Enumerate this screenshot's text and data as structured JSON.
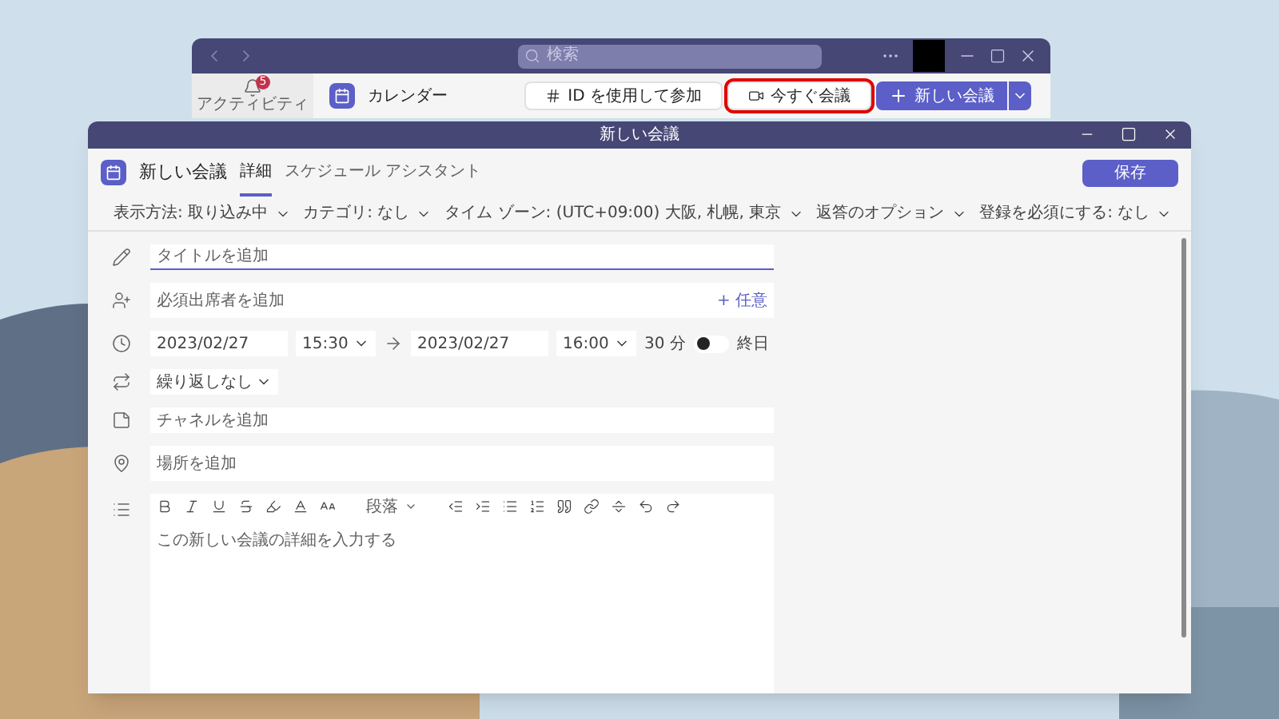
{
  "back_window": {
    "search": {
      "placeholder": "検索"
    },
    "activity": {
      "label": "アクティビティ",
      "badge": "5"
    },
    "app_title": "カレンダー",
    "buttons": [
      {
        "kind": "join",
        "label": "ID を使用して参加",
        "highlighted": false
      },
      {
        "kind": "meet",
        "label": "今すぐ会議",
        "highlighted": true
      },
      {
        "kind": "new",
        "label": "新しい会議",
        "highlighted": false
      }
    ]
  },
  "dialog": {
    "title": "新しい会議",
    "heading": "新しい会議",
    "tabs": [
      {
        "label": "詳細",
        "selected": true
      },
      {
        "label": "スケジュール アシスタント",
        "selected": false
      }
    ],
    "save": "保存",
    "options": [
      "表示方法: 取り込み中",
      "カテゴリ: なし",
      "タイム ゾーン: (UTC+09:00) 大阪, 札幌, 東京",
      "返答のオプション",
      "登録を必須にする: なし"
    ],
    "form": {
      "title": {
        "placeholder": "タイトルを追加"
      },
      "attendees": {
        "placeholder": "必須出席者を追加",
        "optional": "+ 任意"
      },
      "start_date": "2023/02/27",
      "start_time": "15:30",
      "end_date": "2023/02/27",
      "end_time": "16:00",
      "duration": "30 分",
      "all_day": {
        "label": "終日",
        "on": false
      },
      "repeat": "繰り返しなし",
      "channel": {
        "placeholder": "チャネルを追加"
      },
      "location": {
        "placeholder": "場所を追加"
      },
      "editor": {
        "paragraph_style": "段落",
        "placeholder": "この新しい会議の詳細を入力する"
      }
    }
  }
}
